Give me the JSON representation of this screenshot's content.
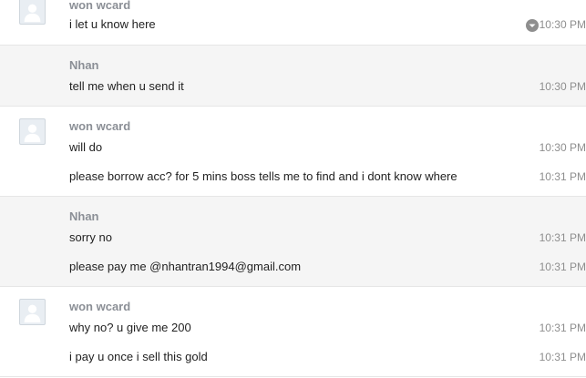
{
  "messages": [
    {
      "sender": "won wcard",
      "lines": [
        {
          "text": "i let u know here",
          "time": "10:30 PM",
          "icon": "chevron-down-icon"
        }
      ]
    },
    {
      "sender": "Nhan",
      "lines": [
        {
          "text": "tell me when u send it",
          "time": "10:30 PM"
        }
      ]
    },
    {
      "sender": "won wcard",
      "lines": [
        {
          "text": "will do",
          "time": "10:30 PM"
        },
        {
          "text": "please borrow acc? for 5 mins boss tells me to find and i dont know where",
          "time": "10:31 PM"
        }
      ]
    },
    {
      "sender": "Nhan",
      "lines": [
        {
          "text": "sorry no",
          "time": "10:31 PM"
        },
        {
          "text": "please pay me @nhantran1994@gmail.com",
          "time": "10:31 PM"
        }
      ]
    },
    {
      "sender": "won wcard",
      "lines": [
        {
          "text": "why no? u give me 200",
          "time": "10:31 PM"
        },
        {
          "text": "i pay u once i sell this gold",
          "time": "10:31 PM"
        }
      ]
    }
  ],
  "colors": {
    "alt_background": "#f5f5f5",
    "sender": "#8b8f96",
    "time": "#8e8e8e"
  }
}
